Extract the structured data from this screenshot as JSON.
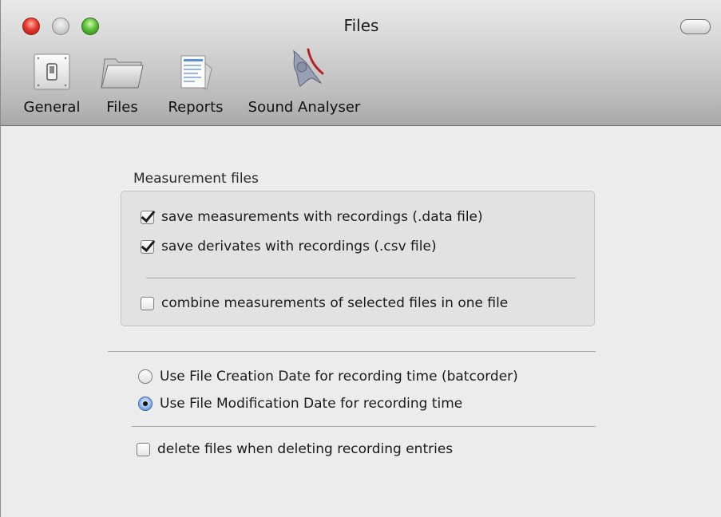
{
  "window": {
    "title": "Files"
  },
  "toolbar": {
    "items": [
      {
        "label": "General",
        "icon": "switch-icon"
      },
      {
        "label": "Files",
        "icon": "folder-icon"
      },
      {
        "label": "Reports",
        "icon": "report-document-icon"
      },
      {
        "label": "Sound Analyser",
        "icon": "bat-icon"
      }
    ],
    "selected": "Files"
  },
  "measurement_files": {
    "label": "Measurement files",
    "options": [
      {
        "label": "save measurements with recordings (.data file)",
        "checked": true
      },
      {
        "label": "save derivates with recordings (.csv file)",
        "checked": true
      },
      {
        "label": "combine measurements of selected files in one file",
        "checked": false
      }
    ]
  },
  "recording_time": {
    "options": [
      {
        "label": "Use File Creation Date for recording time (batcorder)",
        "selected": false
      },
      {
        "label": "Use File Modification Date for recording time",
        "selected": true
      }
    ]
  },
  "delete_option": {
    "label": "delete files when deleting recording entries",
    "checked": false
  },
  "colors": {
    "close_light": "#e8382c",
    "minimize_light": "#cfcfcf",
    "zoom_light": "#5bc13a",
    "radio_selected": "#8fb7ec"
  }
}
